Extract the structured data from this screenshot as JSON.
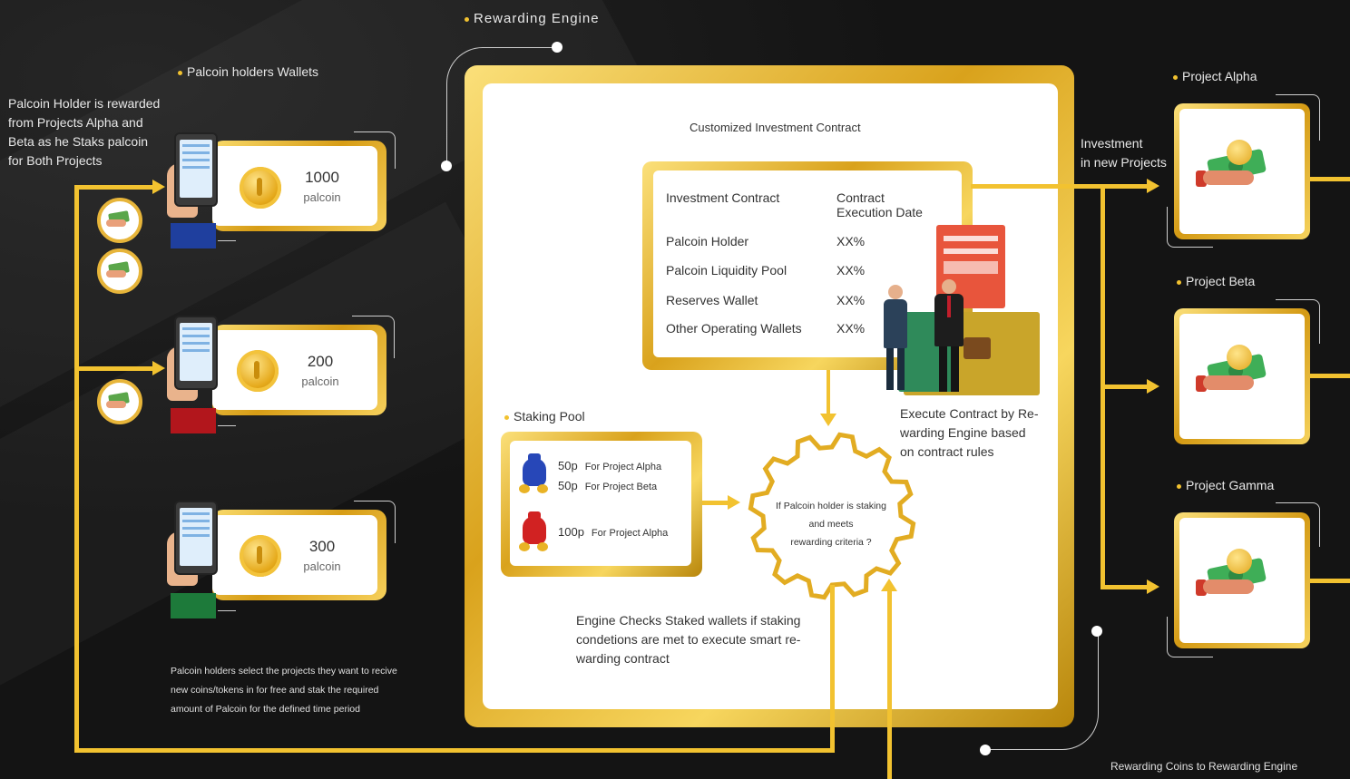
{
  "rewarding_engine": {
    "label": "Rewarding Engine"
  },
  "wallets": {
    "section_label": "Palcoin holders Wallets",
    "intro": [
      "Palcoin Holder is rewarded",
      "from Projects  Alpha and",
      "Beta as he Staks  palcoin",
      "for Both Projects"
    ],
    "items": [
      {
        "amount": "1000",
        "unit": "palcoin",
        "sleeve_color": "#1f3f9e"
      },
      {
        "amount": "200",
        "unit": "palcoin",
        "sleeve_color": "#b2161c"
      },
      {
        "amount": "300",
        "unit": "palcoin",
        "sleeve_color": "#1d7a3a"
      }
    ],
    "footer": [
      "Palcoin holders select the projects they want to recive",
      "new coins/tokens in for free and stak the required",
      "amount of Palcoin for the defined time period"
    ]
  },
  "contract": {
    "title": "Customized Investment Contract",
    "header_left": "Investment Contract",
    "header_right": [
      "Contract",
      "Execution Date"
    ],
    "rows": [
      {
        "name": "Palcoin Holder",
        "value": "XX%"
      },
      {
        "name": "Palcoin Liquidity Pool",
        "value": "XX%"
      },
      {
        "name": "Reserves Wallet",
        "value": "XX%"
      },
      {
        "name": "Other Operating Wallets",
        "value": "XX%"
      }
    ],
    "execute_note": [
      "Execute Contract by Re-",
      "warding Engine based",
      "on contract rules"
    ]
  },
  "staking_pool": {
    "label": "Staking Pool",
    "entries": [
      {
        "amount": "50p",
        "target": "For Project Alpha"
      },
      {
        "amount": "50p",
        "target": "For Project Beta"
      },
      {
        "amount": "100p",
        "target": "For Project Alpha"
      }
    ]
  },
  "gear": {
    "text": [
      "If Palcoin holder is staking",
      "and meets",
      "rewarding criteria ?"
    ]
  },
  "engine_note": [
    "Engine Checks Staked wallets if staking",
    "condetions are met to execute smart  re-",
    "warding contract"
  ],
  "investment_label": [
    "Investment",
    "in new Projects"
  ],
  "projects": [
    {
      "name": "Project Alpha"
    },
    {
      "name": "Project Beta"
    },
    {
      "name": "Project Gamma"
    }
  ],
  "bottom_label": "Rewarding Coins to Rewarding Engine",
  "colors": {
    "gold": "#f2c230",
    "background": "#141414"
  }
}
